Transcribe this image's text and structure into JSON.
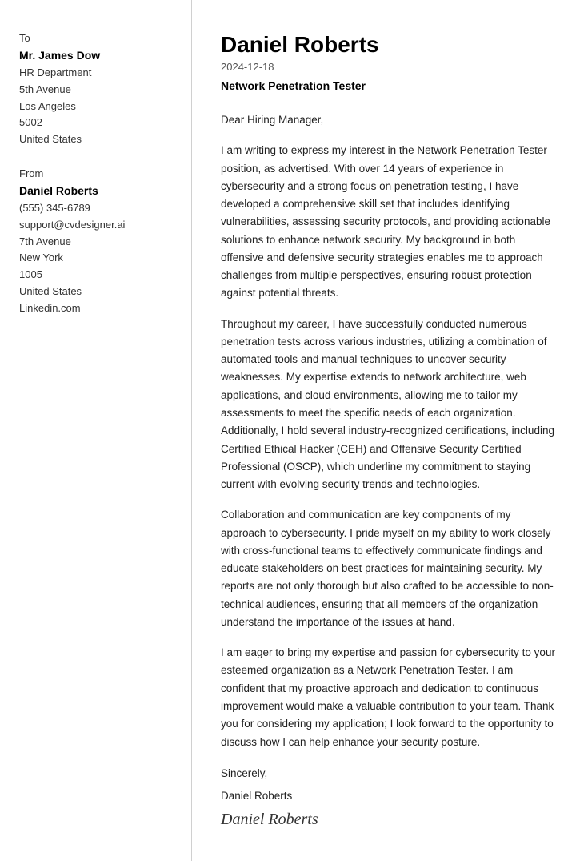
{
  "sidebar": {
    "to_label": "To",
    "recipient": {
      "name": "Mr. James Dow",
      "department": "HR Department",
      "street": "5th Avenue",
      "city": "Los Angeles",
      "zip": "5002",
      "country": "United States"
    },
    "from_label": "From",
    "sender": {
      "name": "Daniel Roberts",
      "phone": "(555) 345-6789",
      "email": "support@cvdesigner.ai",
      "street": "7th Avenue",
      "city": "New York",
      "zip": "1005",
      "country": "United States",
      "website": "Linkedin.com"
    }
  },
  "letter": {
    "name": "Daniel Roberts",
    "date": "2024-12-18",
    "job_title": "Network Penetration Tester",
    "greeting": "Dear Hiring Manager,",
    "paragraph1": "I am writing to express my interest in the Network Penetration Tester position, as advertised. With over 14 years of experience in cybersecurity and a strong focus on penetration testing, I have developed a comprehensive skill set that includes identifying vulnerabilities, assessing security protocols, and providing actionable solutions to enhance network security. My background in both offensive and defensive security strategies enables me to approach challenges from multiple perspectives, ensuring robust protection against potential threats.",
    "paragraph2": "Throughout my career, I have successfully conducted numerous penetration tests across various industries, utilizing a combination of automated tools and manual techniques to uncover security weaknesses. My expertise extends to network architecture, web applications, and cloud environments, allowing me to tailor my assessments to meet the specific needs of each organization. Additionally, I hold several industry-recognized certifications, including Certified Ethical Hacker (CEH) and Offensive Security Certified Professional (OSCP), which underline my commitment to staying current with evolving security trends and technologies.",
    "paragraph3": "Collaboration and communication are key components of my approach to cybersecurity. I pride myself on my ability to work closely with cross-functional teams to effectively communicate findings and educate stakeholders on best practices for maintaining security. My reports are not only thorough but also crafted to be accessible to non-technical audiences, ensuring that all members of the organization understand the importance of the issues at hand.",
    "paragraph4": "I am eager to bring my expertise and passion for cybersecurity to your esteemed organization as a Network Penetration Tester. I am confident that my proactive approach and dedication to continuous improvement would make a valuable contribution to your team. Thank you for considering my application; I look forward to the opportunity to discuss how I can help enhance your security posture.",
    "closing": "Sincerely,",
    "closing_name": "Daniel Roberts",
    "signature_cursive": "Daniel Roberts"
  }
}
